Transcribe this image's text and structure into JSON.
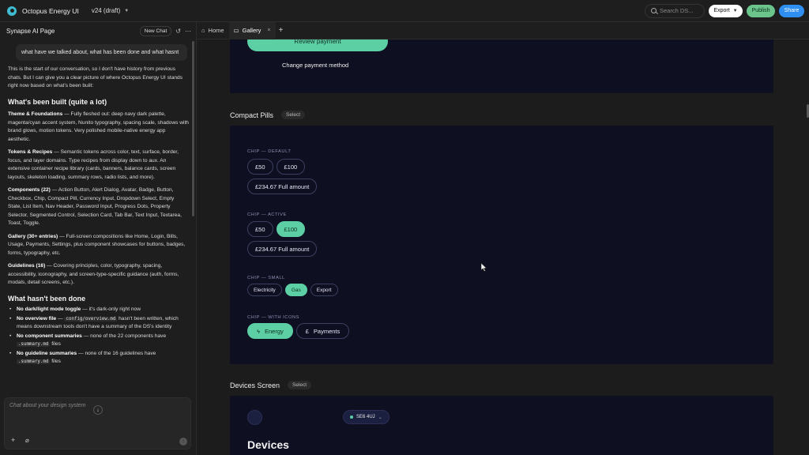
{
  "topbar": {
    "app_title": "Octopus Energy UI",
    "version": "v24 (draft)",
    "search_placeholder": "Search DS...",
    "export_label": "Export",
    "publish_label": "Publish",
    "share_label": "Share"
  },
  "left_panel": {
    "title": "Synapse AI Page",
    "new_chat_label": "New Chat",
    "user_message": "what have we talked about, what has been done and what hasnt",
    "intro": "This is the start of our conversation, so I don't have history from previous chats. But I can give you a clear picture of where Octopus Energy UI stands right now based on what's been built:",
    "built_heading": "What's been built (quite a lot)",
    "built_items": [
      {
        "title": "Theme & Foundations",
        "text": " — Fully fleshed out: deep navy dark palette, magenta/cyan accent system, Nunito typography, spacing scale, shadows with brand glows, motion tokens. Very polished mobile-native energy app aesthetic."
      },
      {
        "title": "Tokens & Recipes",
        "text": " — Semantic tokens across color, text, surface, border, focus, and layer domains. Type recipes from display down to aux. An extensive container recipe library (cards, banners, balance cards, screen layouts, skeleton loading, summary rows, radio lists, and more)."
      },
      {
        "title": "Components (22)",
        "text": " — Action Button, Alert Dialog, Avatar, Badge, Button, Checkbox, Chip, Compact Pill, Currency Input, Dropdown Select, Empty State, List Item, Nav Header, Password Input, Progress Dots, Property Selector, Segmented Control, Selection Card, Tab Bar, Text Input, Textarea, Toast, Toggle."
      },
      {
        "title": "Gallery (30+ entries)",
        "text": " — Full-screen compositions like Home, Login, Bills, Usage, Payments, Settings, plus component showcases for buttons, badges, forms, typography, etc."
      },
      {
        "title": "Guidelines (16)",
        "text": " — Covering principles, color, typography, spacing, accessibility, iconography, and screen-type-specific guidance (auth, forms, modals, detail screens, etc.)."
      }
    ],
    "not_done_heading": "What hasn't been done",
    "not_done": {
      "i1_title": "No dark/light mode toggle",
      "i1_text": " — it's dark-only right now",
      "i2_title": "No overview file",
      "i2_pre": " — ",
      "i2_code": "config/overview.md",
      "i2_text": " hasn't been written, which means downstream tools don't have a summary of the DS's identity",
      "i3_title": "No component summaries",
      "i3_text": " — none of the 22 components have ",
      "i3_code": ".summary.md",
      "i3_tail": " files",
      "i4_title": "No guideline summaries",
      "i4_text": " — none of the 16 guidelines have ",
      "i4_code": ".summary.md",
      "i4_tail": " files"
    },
    "composer_placeholder": "Chat about your design system"
  },
  "tabs": [
    {
      "label": "Home"
    },
    {
      "label": "Gallery"
    }
  ],
  "canvas": {
    "payment": {
      "review_label": "Review payment",
      "change_label": "Change payment method"
    },
    "compact_pills": {
      "title": "Compact Pills",
      "select_label": "Select",
      "default_label": "CHIP — DEFAULT",
      "default_chips": [
        "£50",
        "£100",
        "£234.67 Full amount"
      ],
      "active_label": "CHIP — ACTIVE",
      "active_chips": [
        "£50",
        "£100",
        "£234.67 Full amount"
      ],
      "small_label": "CHIP — SMALL",
      "small_chips": [
        "Electricity",
        "Gas",
        "Export"
      ],
      "icons_label": "CHIP — WITH ICONS",
      "icon_chips": [
        "Energy",
        "Payments"
      ]
    },
    "devices": {
      "title": "Devices Screen",
      "select_label": "Select",
      "pill_label": "SE6 4UJ",
      "heading": "Devices"
    }
  },
  "colors": {
    "accent_teal": "#5ccfa4",
    "frame_navy": "#0f0f22",
    "share_blue": "#2f8ff0",
    "publish_green": "#6ac48c"
  }
}
